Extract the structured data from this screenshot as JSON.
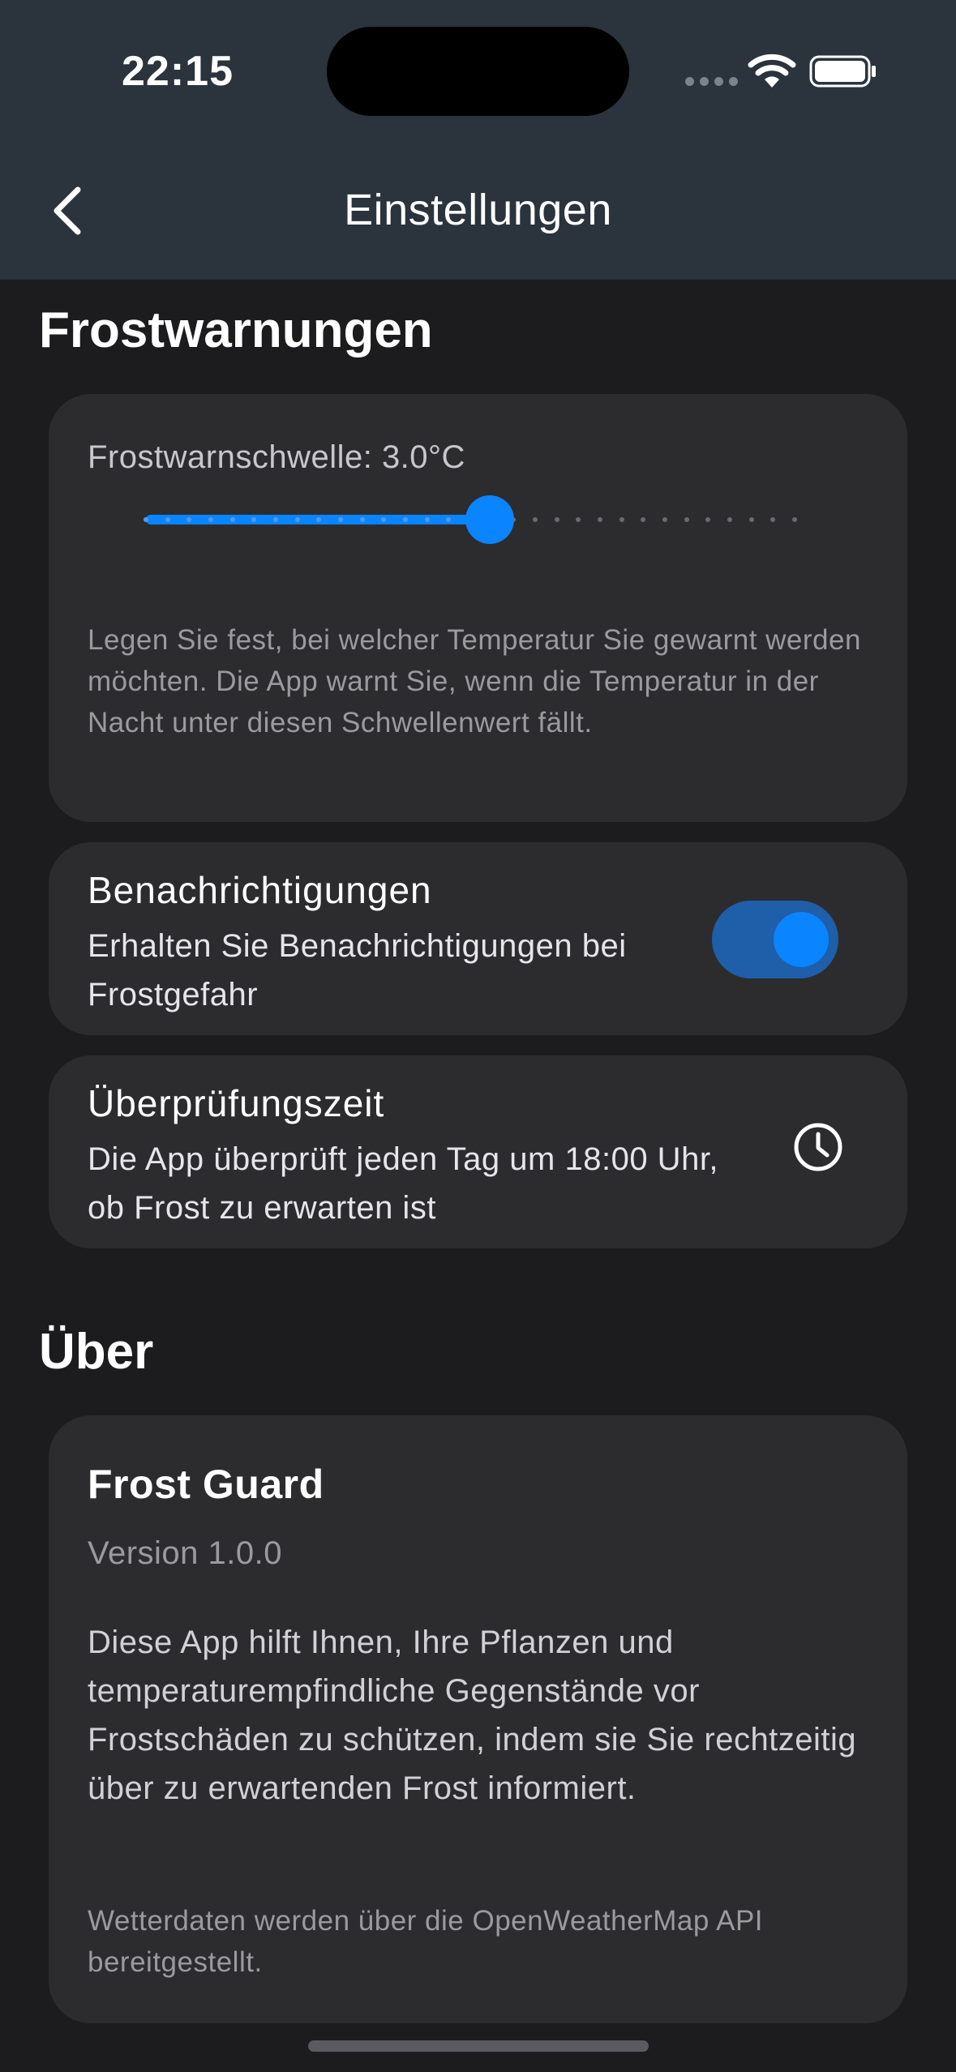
{
  "status_bar": {
    "time": "22:15"
  },
  "nav": {
    "title": "Einstellungen"
  },
  "frost_section": {
    "title": "Frostwarnungen",
    "threshold_label": "Frostwarnschwelle: 3.0°C",
    "slider_value_fraction": 0.53,
    "threshold_description": "Legen Sie fest, bei welcher Temperatur Sie gewarnt werden möchten. Die App warnt Sie, wenn die Temperatur in der Nacht unter diesen Schwellenwert fällt.",
    "notifications": {
      "title": "Benachrichtigungen",
      "subtitle": "Erhalten Sie Benachrichtigungen bei Frostgefahr",
      "enabled": true
    },
    "check_time": {
      "title": "Überprüfungszeit",
      "subtitle": "Die App überprüft jeden Tag um 18:00 Uhr, ob Frost zu erwarten ist",
      "icon": "clock-icon"
    }
  },
  "about_section": {
    "title": "Über",
    "app_name": "Frost Guard",
    "version": "Version 1.0.0",
    "description": "Diese App hilft Ihnen, Ihre Pflanzen und temperaturempfindliche Gegenstände vor Frostschäden zu schützen, indem sie Sie rechtzeitig über zu erwartenden Frost informiert.",
    "credit": "Wetterdaten werden über die OpenWeatherMap API bereitgestellt."
  },
  "colors": {
    "accent": "#0a84ff",
    "toggle_track": "#1f5ea8",
    "background": "#1c1c1e",
    "card": "#2c2c2e",
    "header": "#2b333d"
  }
}
